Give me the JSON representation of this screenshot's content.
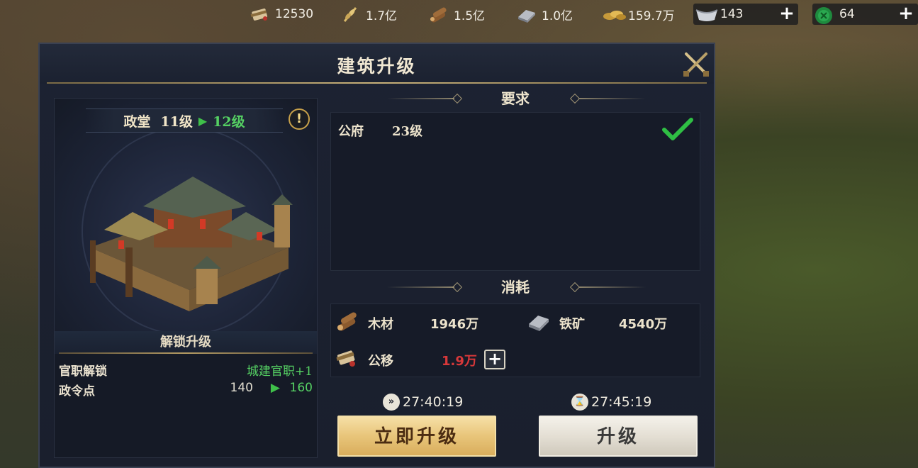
{
  "topbar": {
    "resources": [
      {
        "icon": "scroll-icon",
        "value": "12530"
      },
      {
        "icon": "grain-icon",
        "value": "1.7亿"
      },
      {
        "icon": "wood-icon",
        "value": "1.5亿"
      },
      {
        "icon": "iron-icon",
        "value": "1.0亿"
      },
      {
        "icon": "coins-icon",
        "value": "159.7万"
      },
      {
        "icon": "silver-ingot-icon",
        "value": "143"
      },
      {
        "icon": "jade-icon",
        "value": "64"
      }
    ],
    "plus": "+"
  },
  "dialog": {
    "title": "建筑升级",
    "building": {
      "name": "政堂",
      "from_level": "11级",
      "to_level": "12级",
      "info": "!"
    },
    "unlock": {
      "heading": "解锁升级",
      "rows": [
        {
          "label": "官职解锁",
          "value": "城建官职+1"
        },
        {
          "label": "政令点",
          "from": "140",
          "to": "160"
        }
      ]
    },
    "requirements": {
      "heading": "要求",
      "items": [
        {
          "name": "公府",
          "level": "23级",
          "met": true
        }
      ]
    },
    "costs": {
      "heading": "消耗",
      "items": [
        {
          "icon": "wood-icon",
          "name": "木材",
          "amount": "1946万"
        },
        {
          "icon": "iron-icon",
          "name": "铁矿",
          "amount": "4540万"
        },
        {
          "icon": "scroll-icon",
          "name": "公移",
          "amount": "1.9万",
          "insufficient": true
        }
      ],
      "plus": "+"
    },
    "instant": {
      "time": "27:40:19",
      "label": "立即升级"
    },
    "normal": {
      "time": "27:45:19",
      "label": "升级"
    }
  },
  "colors": {
    "accent_green": "#55d163",
    "warn_red": "#d8383a",
    "gold_button": "#e8c57a"
  }
}
